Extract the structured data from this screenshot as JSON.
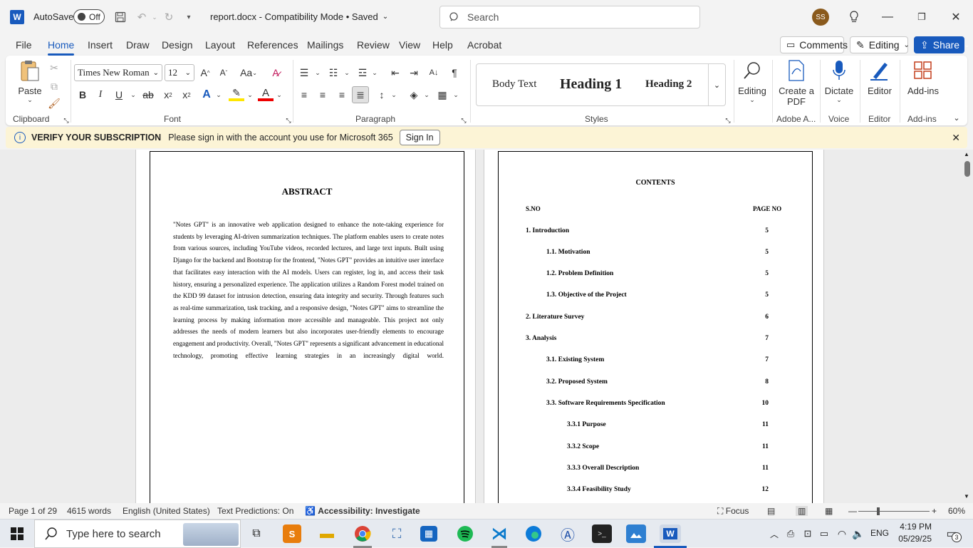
{
  "titlebar": {
    "app_logo": "W",
    "autosave_label": "AutoSave",
    "autosave_state": "Off",
    "document_title": "report.docx  -  Compatibility Mode • Saved",
    "search_placeholder": "Search",
    "user_initials": "SS"
  },
  "tabs": [
    "File",
    "Home",
    "Insert",
    "Draw",
    "Design",
    "Layout",
    "References",
    "Mailings",
    "Review",
    "View",
    "Help",
    "Acrobat"
  ],
  "topbuttons": {
    "comments": "Comments",
    "editing": "Editing",
    "share": "Share"
  },
  "ribbon": {
    "paste": "Paste",
    "font_name": "Times New Roman",
    "font_size": "12",
    "styles": [
      "Body Text",
      "Heading 1",
      "Heading 2"
    ],
    "editing": "Editing",
    "create_pdf": "Create a PDF",
    "dictate": "Dictate",
    "editor": "Editor",
    "addins": "Add-ins",
    "groups": [
      "Clipboard",
      "Font",
      "Paragraph",
      "Styles",
      "Adobe A...",
      "Voice",
      "Editor",
      "Add-ins"
    ]
  },
  "message_bar": {
    "title": "VERIFY YOUR SUBSCRIPTION",
    "text": "Please sign in with the account you use for Microsoft 365",
    "button": "Sign In"
  },
  "page_left": {
    "title": "ABSTRACT",
    "body": "\"Notes GPT\" is an innovative web application designed to enhance the note-taking experience for students by leveraging AI-driven summarization techniques. The platform enables users to create notes from various sources, including YouTube videos, recorded lectures, and large text inputs. Built using Django for the backend and Bootstrap for the frontend, \"Notes GPT\" provides an intuitive user interface that facilitates easy interaction with the AI models. Users can register, log in, and access their task history, ensuring a personalized experience. The application utilizes a Random Forest model trained on the KDD 99 dataset for intrusion detection, ensuring data integrity and security. Through features such as real-time summarization, task tracking, and a responsive design, \"Notes GPT\" aims to streamline the learning process by making information more accessible and manageable. This project not only addresses the needs of modern learners but also incorporates user-friendly elements to encourage engagement and productivity. Overall, \"Notes GPT\" represents a significant advancement in educational technology, promoting effective learning strategies in an increasingly digital world."
  },
  "page_right": {
    "title": "CONTENTS",
    "col_sno": "S.NO",
    "col_page": "PAGE NO",
    "entries": [
      {
        "label": "1. Introduction",
        "page": "5",
        "level": 0
      },
      {
        "label": "1.1. Motivation",
        "page": "5",
        "level": 1
      },
      {
        "label": "1.2. Problem Definition",
        "page": "5",
        "level": 1
      },
      {
        "label": "1.3. Objective of the Project",
        "page": "5",
        "level": 1
      },
      {
        "label": "2. Literature Survey",
        "page": "6",
        "level": 0
      },
      {
        "label": "3. Analysis",
        "page": "7",
        "level": 0
      },
      {
        "label": "3.1. Existing System",
        "page": "7",
        "level": 1
      },
      {
        "label": "3.2. Proposed System",
        "page": "8",
        "level": 1
      },
      {
        "label": "3.3. Software Requirements Specification",
        "page": "10",
        "level": 1
      },
      {
        "label": "3.3.1 Purpose",
        "page": "11",
        "level": 2
      },
      {
        "label": "3.3.2 Scope",
        "page": "11",
        "level": 2
      },
      {
        "label": "3.3.3 Overall Description",
        "page": "11",
        "level": 2
      },
      {
        "label": "3.3.4 Feasibility Study",
        "page": "12",
        "level": 2
      }
    ]
  },
  "statusbar": {
    "page": "Page 1 of 29",
    "words": "4615 words",
    "language": "English (United States)",
    "predictions": "Text Predictions: On",
    "accessibility": "Accessibility: Investigate",
    "focus": "Focus",
    "zoom": "60%"
  },
  "taskbar": {
    "search_placeholder": "Type here to search",
    "language": "ENG",
    "time": "4:19 PM",
    "date": "05/29/25",
    "notification_count": "3"
  },
  "colors": {
    "accent": "#185abd",
    "message_bar": "#fcf4d6"
  }
}
